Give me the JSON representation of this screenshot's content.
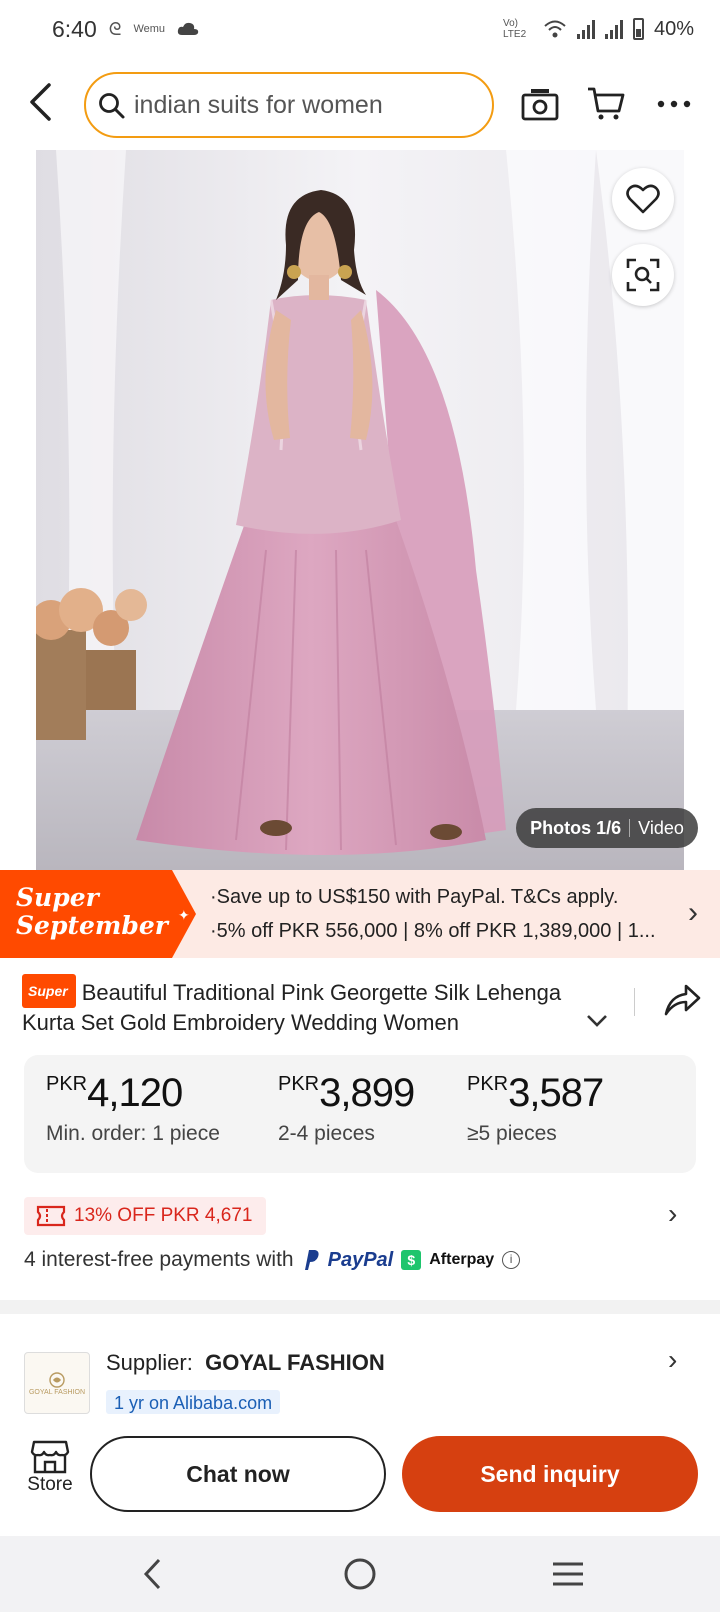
{
  "status_bar": {
    "time": "6:40",
    "notif_text": "Wemu",
    "network": "Vo) LTE2",
    "battery": "40%"
  },
  "header": {
    "search_query": "indian suits for women",
    "icons": [
      "back-icon",
      "search-icon",
      "camera-icon",
      "cart-icon",
      "more-icon"
    ]
  },
  "gallery": {
    "photos_label": "Photos 1/6",
    "video_label": "Video",
    "colors": {
      "dress": "#d9a3be",
      "background": "#ece9ee"
    }
  },
  "promo": {
    "title_line1": "Super",
    "title_line2": "September",
    "line1": "Save up to US$150 with PayPal. T&Cs apply.",
    "line2": "5% off PKR 556,000 | 8% off PKR 1,389,000 | 1...",
    "colors": {
      "badge": "#ff4a00",
      "background": "#fdeae4"
    }
  },
  "product": {
    "badge": "Super",
    "title": "Beautiful Traditional Pink Georgette Silk Lehenga Kurta Set Gold Embroidery Wedding Women"
  },
  "pricing": {
    "tiers": [
      {
        "currency": "PKR",
        "amount": "4,120",
        "qty": "Min. order: 1 piece"
      },
      {
        "currency": "PKR",
        "amount": "3,899",
        "qty": "2-4 pieces"
      },
      {
        "currency": "PKR",
        "amount": "3,587",
        "qty": "≥5 pieces"
      }
    ]
  },
  "discount": {
    "label": "13% OFF PKR 4,671"
  },
  "payments": {
    "text": "4 interest-free payments with",
    "paypal": "PayPal",
    "afterpay": "Afterpay"
  },
  "supplier": {
    "label": "Supplier:",
    "name": "GOYAL FASHION",
    "years": "1 yr on Alibaba.com",
    "logo_text": "GOYAL FASHION"
  },
  "actions": {
    "store": "Store",
    "chat": "Chat now",
    "inquiry": "Send inquiry",
    "colors": {
      "primary": "#d64010"
    }
  }
}
